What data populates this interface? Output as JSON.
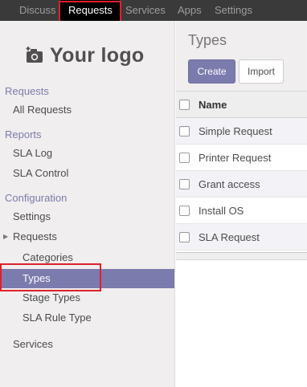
{
  "topnav": {
    "items": [
      "Discuss",
      "Requests",
      "Services",
      "Apps",
      "Settings"
    ]
  },
  "logo": {
    "text": "Your logo",
    "icon": "camera-icon"
  },
  "sidebar": {
    "sections": [
      {
        "title": "Requests",
        "items": [
          "All Requests"
        ]
      },
      {
        "title": "Reports",
        "items": [
          "SLA Log",
          "SLA Control"
        ]
      },
      {
        "title": "Configuration",
        "items": [
          "Settings",
          "Requests",
          "Categories",
          "Types",
          "Stage Types",
          "SLA Rule Type",
          "Services"
        ]
      }
    ],
    "active_item": "Types"
  },
  "main": {
    "title": "Types",
    "create_label": "Create",
    "import_label": "Import",
    "table": {
      "header": "Name",
      "rows": [
        "Simple Request",
        "Printer Request",
        "Grant access",
        "Install OS",
        "SLA Request"
      ]
    }
  },
  "colors": {
    "accent": "#7c7bad",
    "navbar": "#3a3a3a",
    "highlight": "#e0202b"
  }
}
